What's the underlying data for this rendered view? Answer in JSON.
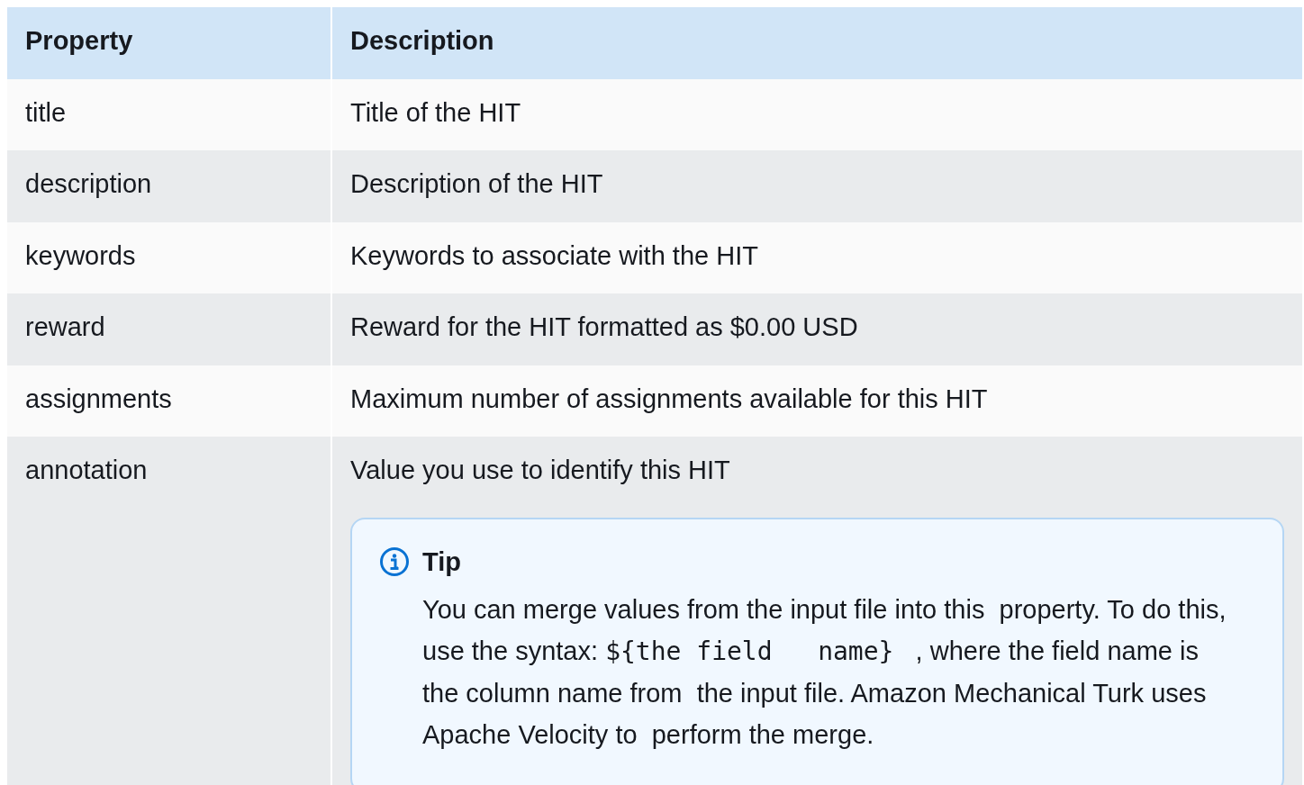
{
  "table": {
    "columns": [
      "Property",
      "Description"
    ],
    "rows": [
      {
        "property": "title",
        "description": "Title of the HIT"
      },
      {
        "property": "description",
        "description": "Description of the HIT"
      },
      {
        "property": "keywords",
        "description": "Keywords to associate with the HIT"
      },
      {
        "property": "reward",
        "description": "Reward for the HIT formatted as $0.00 USD"
      },
      {
        "property": "assignments",
        "description": "Maximum number of assignments available for this HIT"
      },
      {
        "property": "annotation",
        "description": "Value you use to identify this HIT",
        "tip": {
          "title": "Tip",
          "text_parts": [
            {
              "kind": "text",
              "text": "You can merge values from the input file into this  property. To do this, use the syntax: "
            },
            {
              "kind": "code",
              "text": "${the field   name}"
            },
            {
              "kind": "text",
              "text": "   , where the field name is the column name from  the input file. Amazon Mechanical Turk uses Apache Velocity to  perform the merge."
            }
          ]
        }
      }
    ]
  }
}
